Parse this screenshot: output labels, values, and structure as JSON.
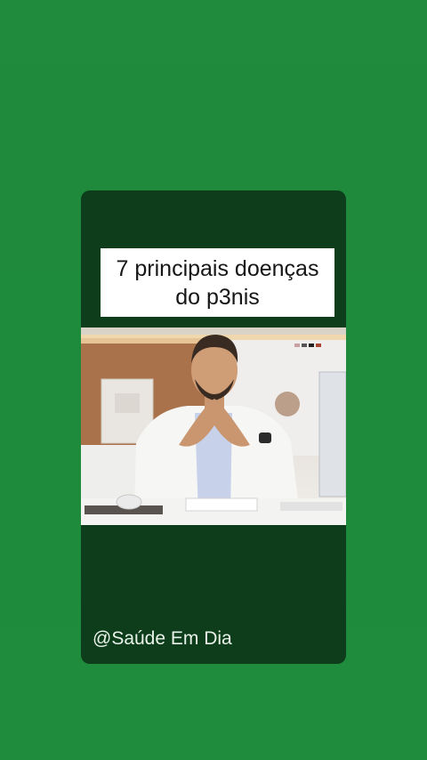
{
  "caption": {
    "line1": "7 principais doenças",
    "line2": "do p3nis"
  },
  "handle": "@Saúde Em Dia",
  "colors": {
    "background": "#1f8a3c",
    "card": "#0d3d1b",
    "caption_bg": "#ffffff"
  }
}
